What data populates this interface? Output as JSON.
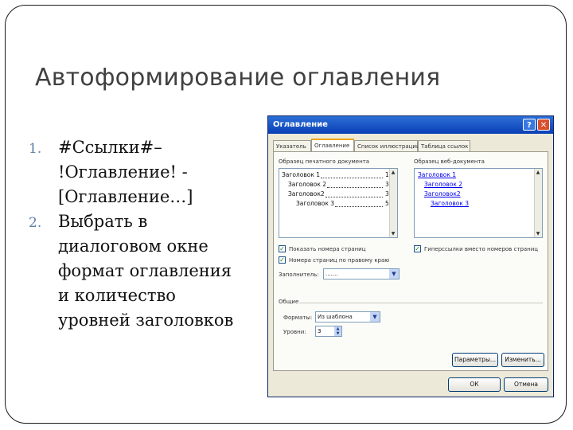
{
  "slide": {
    "title": "Автоформирование оглавления",
    "items": [
      {
        "number": "1.",
        "lines": [
          "#Ссылки#–",
          "!Оглавление! -",
          "[Оглавление…]"
        ]
      },
      {
        "number": "2.",
        "lines": [
          "Выбрать в",
          "диалоговом окне",
          "формат оглавления",
          "и количество",
          "уровней заголовков"
        ]
      }
    ]
  },
  "dialog": {
    "title": "Оглавление",
    "help_label": "?",
    "close_label": "✕",
    "tabs": [
      "Указатель",
      "Оглавление",
      "Список иллюстраций",
      "Таблица ссылок"
    ],
    "print_preview_label": "Образец печатного документа",
    "web_preview_label": "Образец веб-документа",
    "print_preview": [
      {
        "text": "Заголовок 1",
        "page": "1"
      },
      {
        "text": "Заголовок 2",
        "page": "3"
      },
      {
        "text": "Заголовок2",
        "page": "3"
      },
      {
        "text": "Заголовок 3",
        "page": "5"
      }
    ],
    "web_preview": [
      "Заголовок 1",
      "Заголовок 2",
      "Заголовок2",
      "Заголовок 3"
    ],
    "show_page_numbers_label": "Показать номера страниц",
    "right_align_label": "Номера страниц по правому краю",
    "hyperlinks_label": "Гиперссылки вместо номеров страниц",
    "tab_leader_label": "Заполнитель:",
    "tab_leader_value": ".......",
    "general_label": "Общие",
    "formats_label": "Форматы:",
    "formats_value": "Из шаблона",
    "levels_label": "Уровни:",
    "levels_value": "3",
    "options_button": "Параметры...",
    "modify_button": "Изменить...",
    "ok_button": "ОК",
    "cancel_button": "Отмена",
    "colors": {
      "titlebar": "#0a3fb5",
      "link": "#0000ee",
      "dialog_bg": "#ece9d8"
    }
  }
}
